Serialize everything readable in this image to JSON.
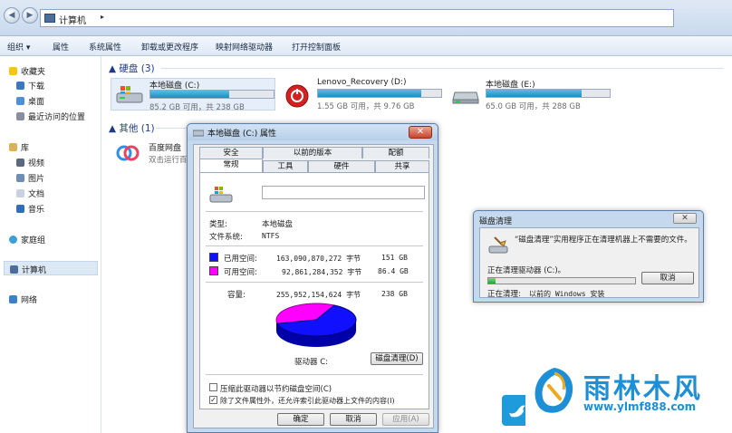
{
  "explorer": {
    "address_path": "计算机",
    "toolbar": [
      "组织 ▾",
      "属性",
      "系统属性",
      "卸载或更改程序",
      "映射网络驱动器",
      "打开控制面板"
    ],
    "nav": {
      "favorites": "收藏夹",
      "downloads": "下载",
      "desktop": "桌面",
      "recent": "最近访问的位置",
      "libraries": "库",
      "videos": "视频",
      "pictures": "图片",
      "documents": "文档",
      "music": "音乐",
      "homegroup": "家庭组",
      "computer": "计算机",
      "network": "网络"
    },
    "groups": {
      "hard_disks": "硬盘 (3)",
      "other": "其他 (1)"
    },
    "drives": [
      {
        "name": "本地磁盘 (C:)",
        "info": "85.2 GB 可用，共 238 GB",
        "used_fraction": 0.64
      },
      {
        "name": "Lenovo_Recovery (D:)",
        "info": "1.55 GB 可用，共 9.76 GB",
        "used_fraction": 0.84
      },
      {
        "name": "本地磁盘 (E:)",
        "info": "65.0 GB 可用，共 288 GB",
        "used_fraction": 0.77
      }
    ],
    "other_item": {
      "name": "百度网盘",
      "desc": "双击运行百"
    }
  },
  "properties": {
    "title": "本地磁盘 (C:) 属性",
    "tabs_back": [
      "安全",
      "以前的版本",
      "配额"
    ],
    "tabs_front": [
      "常规",
      "工具",
      "硬件",
      "共享"
    ],
    "type_label": "类型:",
    "type_value": "本地磁盘",
    "fs_label": "文件系统:",
    "fs_value": "NTFS",
    "used_label": "已用空间:",
    "used_bytes": "163,090,870,272 字节",
    "used_size": "151 GB",
    "free_label": "可用空间:",
    "free_bytes": "92,861,284,352 字节",
    "free_size": "86.4 GB",
    "cap_label": "容量:",
    "cap_bytes": "255,952,154,624 字节",
    "cap_size": "238 GB",
    "drive_label": "驱动器 C:",
    "cleanup_button": "磁盘清理(D)",
    "compress_label": "压缩此驱动器以节约磁盘空间(C)",
    "index_label": "除了文件属性外，还允许索引此驱动器上文件的内容(I)",
    "ok": "确定",
    "cancel": "取消",
    "apply": "应用(A)",
    "used_color": "#1010ff",
    "free_color": "#ff00ff",
    "used_fraction": 0.637
  },
  "cleanup": {
    "title": "磁盘清理",
    "message": "“磁盘清理”实用程序正在清理机器上不需要的文件。",
    "status_label": "正在清理驱动器  (C:)。",
    "cancel": "取消",
    "current_label": "正在清理:",
    "current_value": "以前的 Windows 安装",
    "progress": 0.05
  },
  "watermark": {
    "brand": "雨林木风",
    "url": "www.ylmf888.com"
  }
}
